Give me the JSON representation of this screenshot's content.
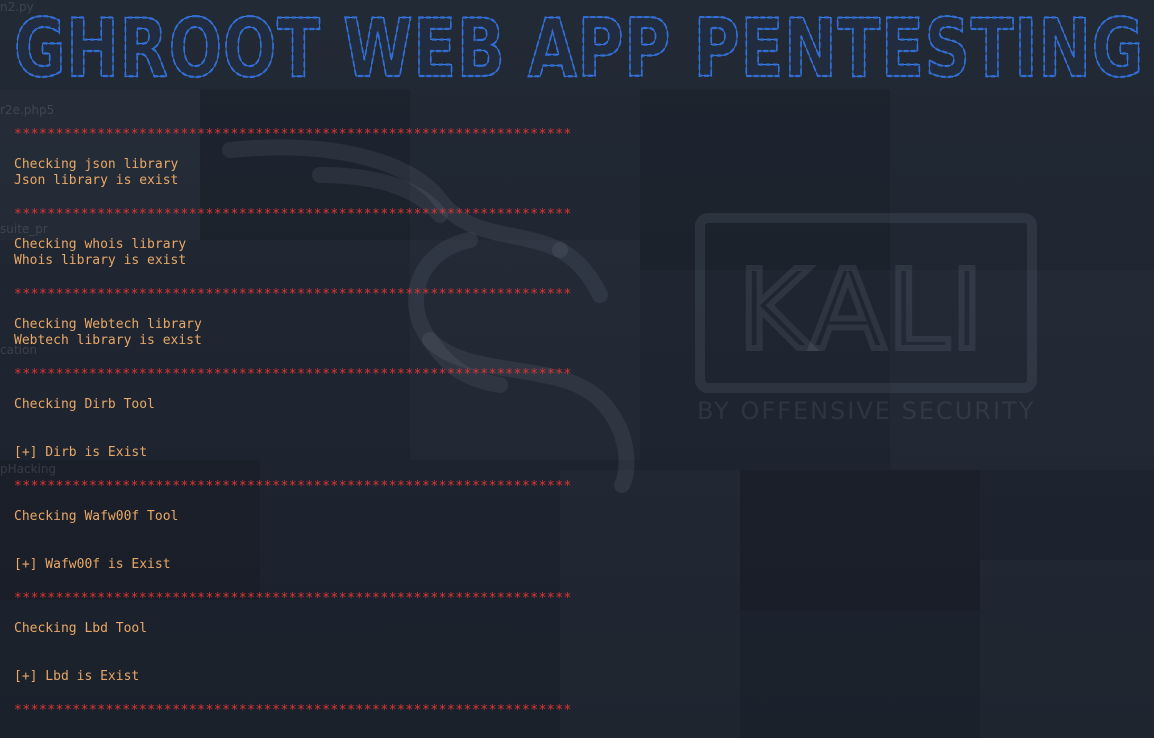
{
  "banner": {
    "title": "GHROOT WEB APP PENTESTING"
  },
  "colors": {
    "banner": "#2f6ed8",
    "separator": "#e03434",
    "message": "#e8a866",
    "background": "#1f2530"
  },
  "wallpaper": {
    "brand": "KALI",
    "tagline": "BY OFFENSIVE SECURITY",
    "icon": "kali-dragon-icon"
  },
  "desktop_icons": [
    "n2.py",
    "r2e.php5",
    "suite_pr",
    "cation",
    "pHacking"
  ],
  "terminal": {
    "separator": "*******************************************************************",
    "lines": [
      "Checking json library",
      "Json library is exist",
      "Checking whois library",
      "Whois library is exist",
      "Checking Webtech library",
      "Webtech library is exist",
      "Checking Dirb Tool",
      "[+] Dirb is Exist",
      "Checking Wafw00f Tool",
      "[+] Wafw00f is Exist",
      "Checking Lbd Tool",
      "[+] Lbd is Exist"
    ]
  }
}
